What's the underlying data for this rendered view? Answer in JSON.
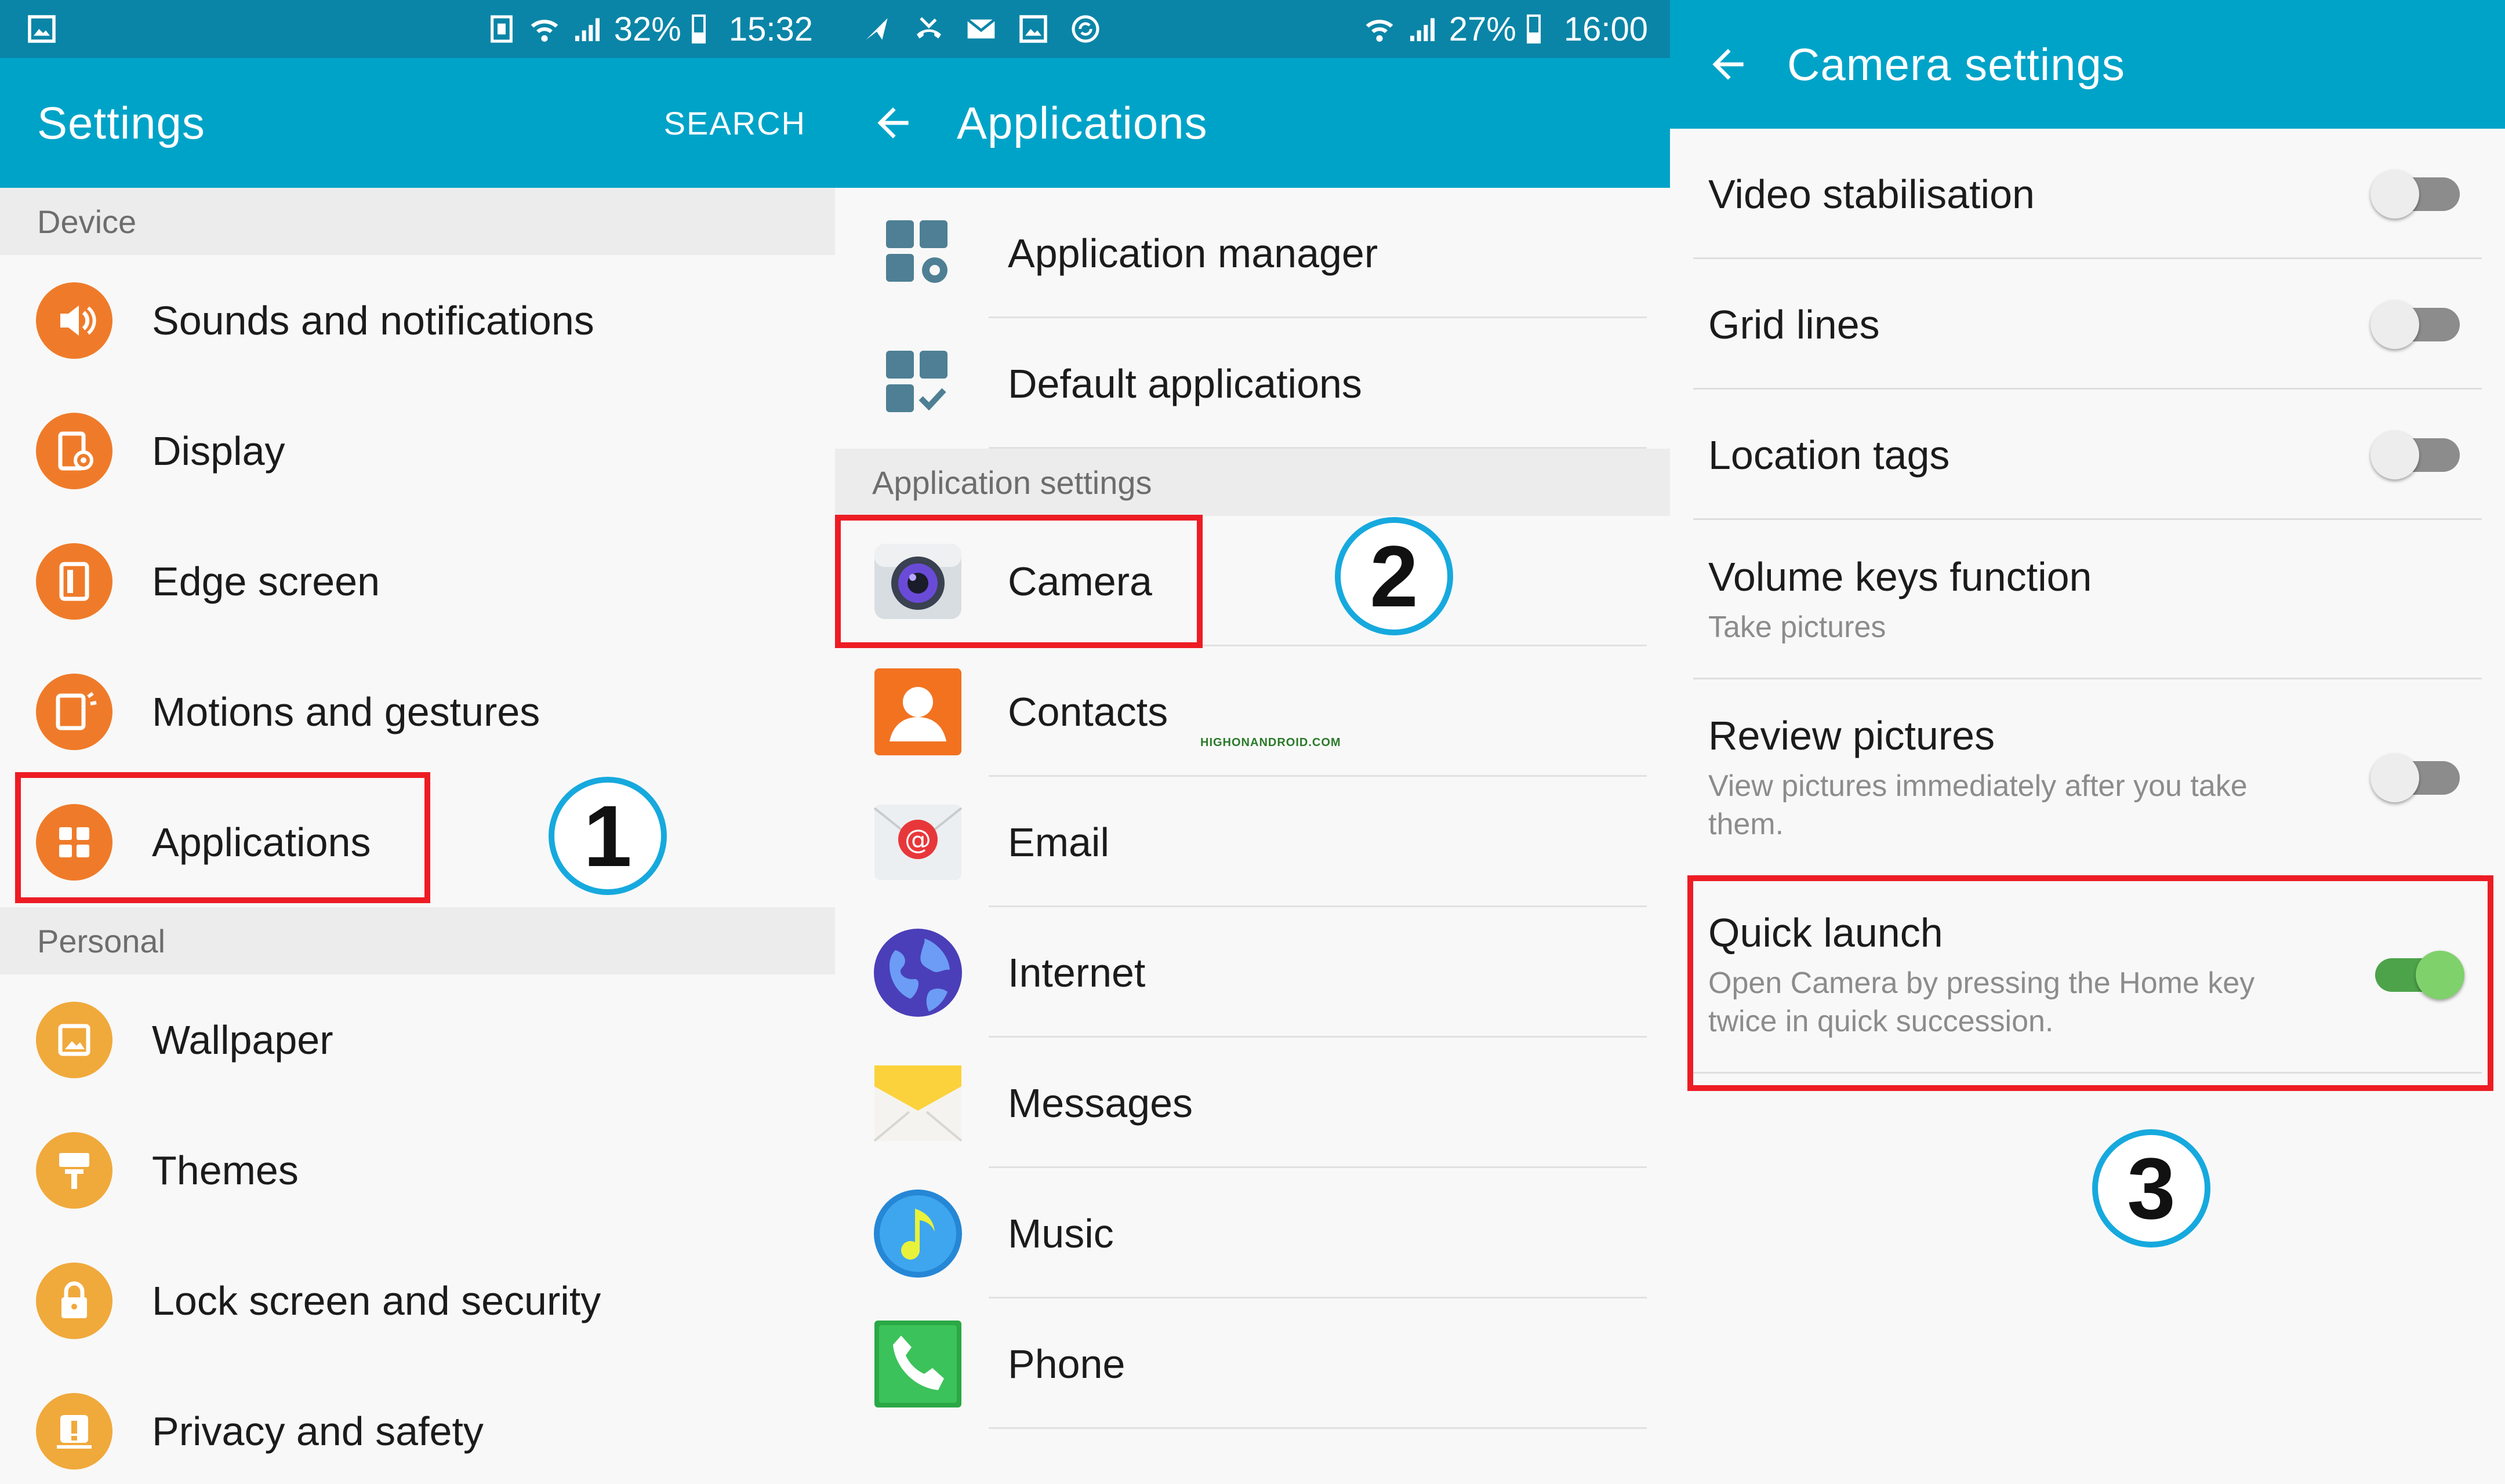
{
  "colors": {
    "status_bar": "#0a85a7",
    "app_bar": "#00a3c8",
    "settings_icon_orange": "#ef7b2a",
    "personal_icon_amber": "#f0a93b",
    "highlight_red": "#ed1c24",
    "step_circle_blue": "#16a9de",
    "toggle_on_green": "#4ca34a"
  },
  "screen1": {
    "status": {
      "battery": "32%",
      "time": "15:32",
      "icons": [
        "picture-icon",
        "nfc-icon",
        "wifi-icon",
        "signal-icon",
        "battery-icon"
      ]
    },
    "header": {
      "title": "Settings",
      "search": "SEARCH"
    },
    "sections": [
      {
        "title": "Device",
        "items": [
          {
            "label": "Sounds and notifications",
            "icon": "speaker-icon"
          },
          {
            "label": "Display",
            "icon": "display-icon"
          },
          {
            "label": "Edge screen",
            "icon": "edge-screen-icon"
          },
          {
            "label": "Motions and gestures",
            "icon": "motion-icon"
          },
          {
            "label": "Applications",
            "icon": "apps-grid-icon"
          }
        ]
      },
      {
        "title": "Personal",
        "items": [
          {
            "label": "Wallpaper",
            "icon": "wallpaper-icon"
          },
          {
            "label": "Themes",
            "icon": "paint-roller-icon"
          },
          {
            "label": "Lock screen and security",
            "icon": "lock-icon"
          },
          {
            "label": "Privacy and safety",
            "icon": "alert-icon"
          }
        ]
      }
    ],
    "step": "1"
  },
  "screen2": {
    "status": {
      "battery": "27%",
      "time": "16:00",
      "icons": [
        "send-icon",
        "missed-call-icon",
        "mail-icon",
        "picture-icon",
        "sync-icon",
        "wifi-icon",
        "signal-icon",
        "battery-icon"
      ]
    },
    "header": {
      "title": "Applications"
    },
    "items_top": [
      {
        "label": "Application manager",
        "icon": "app-manager-icon"
      },
      {
        "label": "Default applications",
        "icon": "default-apps-icon"
      }
    ],
    "section_title": "Application settings",
    "items": [
      {
        "label": "Camera",
        "icon": "camera-icon"
      },
      {
        "label": "Contacts",
        "icon": "contacts-icon"
      },
      {
        "label": "Email",
        "icon": "email-icon"
      },
      {
        "label": "Internet",
        "icon": "globe-icon"
      },
      {
        "label": "Messages",
        "icon": "messages-icon"
      },
      {
        "label": "Music",
        "icon": "music-icon"
      },
      {
        "label": "Phone",
        "icon": "phone-icon"
      }
    ],
    "watermark": "HIGHONANDROID.COM",
    "step": "2"
  },
  "screen3": {
    "header": {
      "title": "Camera settings"
    },
    "items": [
      {
        "label": "Video stabilisation",
        "sub": "",
        "toggle": false
      },
      {
        "label": "Grid lines",
        "sub": "",
        "toggle": false
      },
      {
        "label": "Location tags",
        "sub": "",
        "toggle": false
      },
      {
        "label": "Volume keys function",
        "sub": "Take pictures"
      },
      {
        "label": "Review pictures",
        "sub": "View pictures immediately after you take them.",
        "toggle": false
      },
      {
        "label": "Quick launch",
        "sub": "Open Camera by pressing the Home key twice in quick succession.",
        "toggle": true
      }
    ],
    "step": "3"
  }
}
